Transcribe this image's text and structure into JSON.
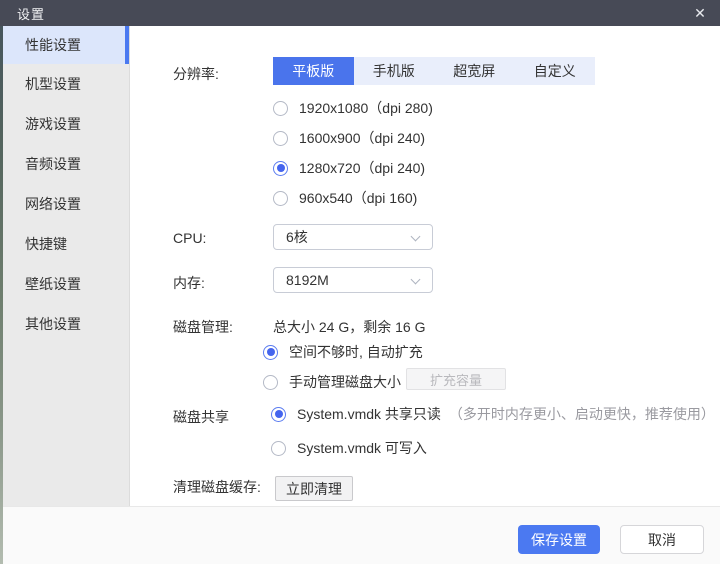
{
  "window": {
    "title": "设置",
    "close_icon": "✕"
  },
  "sidebar": {
    "items": [
      {
        "label": "性能设置",
        "selected": true
      },
      {
        "label": "机型设置",
        "selected": false
      },
      {
        "label": "游戏设置",
        "selected": false
      },
      {
        "label": "音频设置",
        "selected": false
      },
      {
        "label": "网络设置",
        "selected": false
      },
      {
        "label": "快捷键",
        "selected": false
      },
      {
        "label": "壁纸设置",
        "selected": false
      },
      {
        "label": "其他设置",
        "selected": false
      }
    ]
  },
  "main": {
    "resolution": {
      "label": "分辨率:",
      "tabs": [
        {
          "label": "平板版",
          "selected": true
        },
        {
          "label": "手机版",
          "selected": false
        },
        {
          "label": "超宽屏",
          "selected": false
        },
        {
          "label": "自定义",
          "selected": false
        }
      ],
      "options": [
        {
          "label": "1920x1080（dpi 280)",
          "selected": false
        },
        {
          "label": "1600x900（dpi 240)",
          "selected": false
        },
        {
          "label": "1280x720（dpi 240)",
          "selected": true
        },
        {
          "label": "960x540（dpi 160)",
          "selected": false
        }
      ]
    },
    "cpu": {
      "label": "CPU:",
      "value": "6核"
    },
    "memory": {
      "label": "内存:",
      "value": "8192M"
    },
    "disk_management": {
      "label": "磁盘管理:",
      "summary": "总大小 24 G，剩余 16 G",
      "options": [
        {
          "label": "空间不够时, 自动扩充",
          "selected": true
        },
        {
          "label": "手动管理磁盘大小",
          "selected": false
        }
      ],
      "expand_button": "扩充容量"
    },
    "disk_sharing": {
      "label": "磁盘共享",
      "options": [
        {
          "label": "System.vmdk 共享只读",
          "note": "（多开时内存更小、启动更快，推荐使用）",
          "selected": true
        },
        {
          "label": "System.vmdk 可写入",
          "note": "",
          "selected": false
        }
      ]
    },
    "clean_cache": {
      "label": "清理磁盘缓存:",
      "button": "立即清理"
    }
  },
  "footer": {
    "save": "保存设置",
    "cancel": "取消"
  },
  "colors": {
    "titlebar": "#474a56",
    "accent": "#4a74ec",
    "sidebar_selected_bg": "#dce6fb",
    "sidebar_bg": "#eaeaea",
    "radio_accent": "#4565ee",
    "tabbar_bg": "#e9eefb",
    "footer_bg": "#fafafa",
    "save_button_bg": "#4b79f1",
    "disabled_text": "#b9b9bd"
  }
}
